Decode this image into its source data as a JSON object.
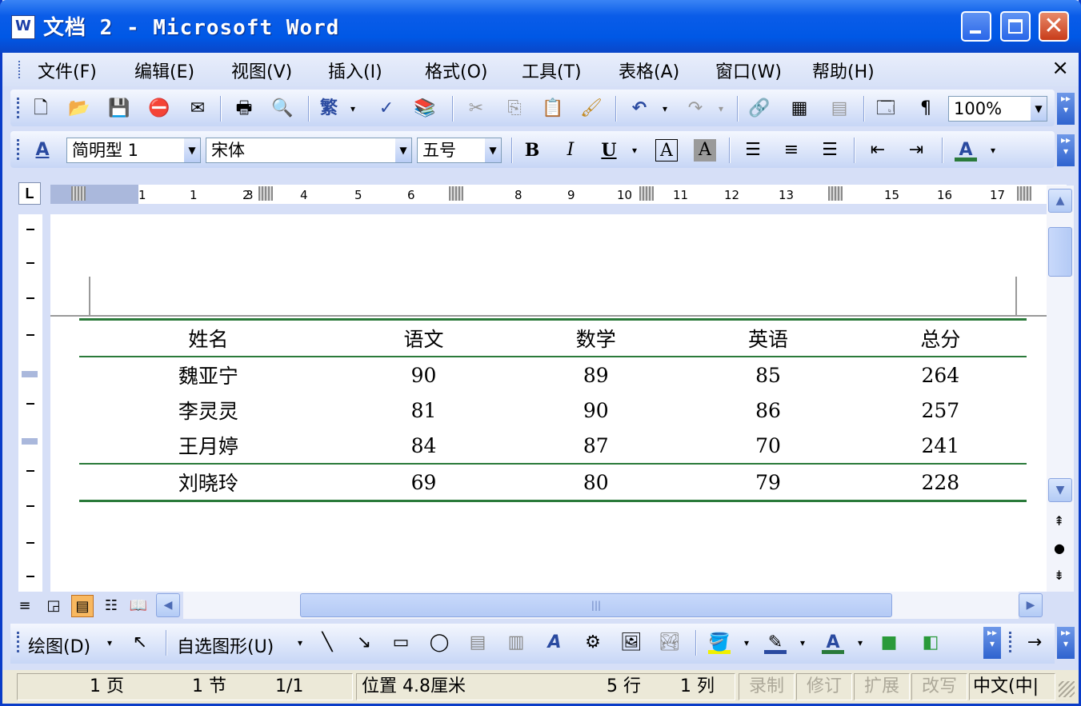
{
  "window": {
    "title": "文档 2 - Microsoft Word"
  },
  "menu": {
    "items": [
      "文件(F)",
      "编辑(E)",
      "视图(V)",
      "插入(I)",
      "格式(O)",
      "工具(T)",
      "表格(A)",
      "窗口(W)",
      "帮助(H)"
    ],
    "close": "×"
  },
  "standard_toolbar": {
    "zoom": "100%"
  },
  "format_toolbar": {
    "style": "简明型 1",
    "font": "宋体",
    "size": "五号",
    "bold": "B",
    "italic": "I",
    "underline": "U",
    "font_color_label": "A"
  },
  "ruler": {
    "numbers": [
      "1",
      "1",
      "2",
      "3",
      "4",
      "5",
      "6",
      "8",
      "9",
      "10",
      "11",
      "12",
      "13",
      "15",
      "16",
      "17"
    ]
  },
  "table": {
    "headers": [
      "姓名",
      "语文",
      "数学",
      "英语",
      "总分"
    ],
    "rows": [
      [
        "魏亚宁",
        "90",
        "89",
        "85",
        "264"
      ],
      [
        "李灵灵",
        "81",
        "90",
        "86",
        "257"
      ],
      [
        "王月婷",
        "84",
        "87",
        "70",
        "241"
      ],
      [
        "刘晓玲",
        "69",
        "80",
        "79",
        "228"
      ]
    ]
  },
  "draw_toolbar": {
    "draw": "绘图(D)",
    "autoshapes": "自选图形(U)"
  },
  "status": {
    "page": "1 页",
    "section": "1 节",
    "pages": "1/1",
    "position": "位置 4.8厘米",
    "line": "5 行",
    "col": "1 列",
    "rec": "录制",
    "trk": "修订",
    "ext": "扩展",
    "ovr": "改写",
    "lang": "中文(中|"
  },
  "colors": {
    "table_rule": "#2a7a3a",
    "title_bar": "#0058e6"
  }
}
